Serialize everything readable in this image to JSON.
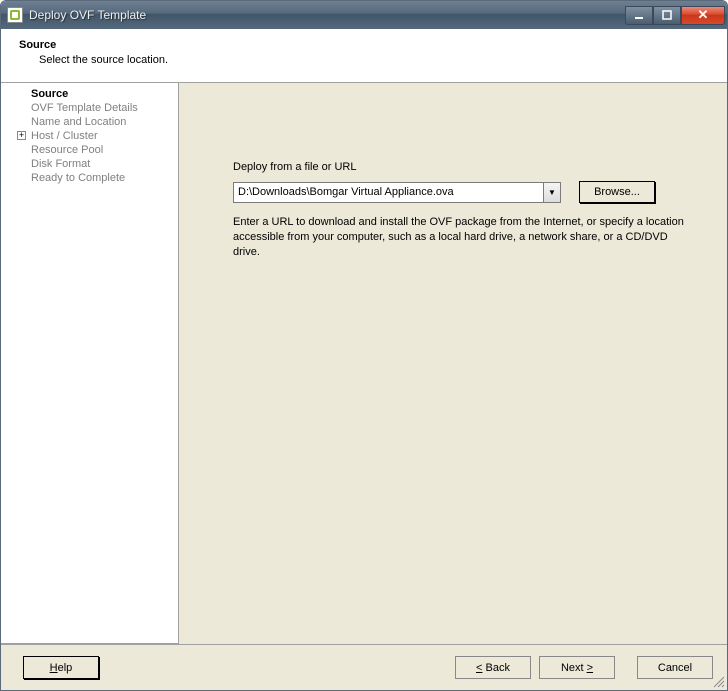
{
  "window": {
    "title": "Deploy OVF Template"
  },
  "header": {
    "title": "Source",
    "subtitle": "Select the source location."
  },
  "sidebar": {
    "items": [
      {
        "label": "Source",
        "active": true
      },
      {
        "label": "OVF Template Details"
      },
      {
        "label": "Name and Location"
      },
      {
        "label": "Host / Cluster",
        "expandable": true
      },
      {
        "label": "Resource Pool"
      },
      {
        "label": "Disk Format"
      },
      {
        "label": "Ready to Complete"
      }
    ]
  },
  "form": {
    "label": "Deploy from a file or URL",
    "path_value": "D:\\Downloads\\Bomgar Virtual Appliance.ova",
    "browse_label": "Browse...",
    "help_text": "Enter a URL to download and install the OVF package from the Internet, or specify a location accessible from your computer, such as a local hard drive, a network share, or a CD/DVD drive."
  },
  "footer": {
    "help_label": "Help",
    "back_label": "Back",
    "next_label": "Next",
    "cancel_label": "Cancel"
  }
}
